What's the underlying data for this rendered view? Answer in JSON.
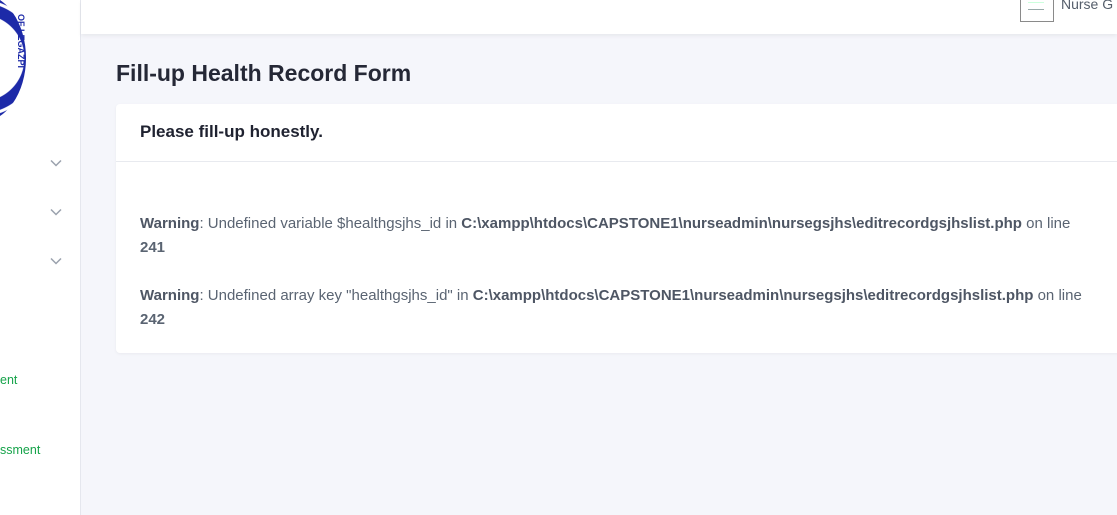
{
  "sidebar": {
    "logo_text": "OF LEGAZPI",
    "links": [
      {
        "label": "ent"
      },
      {
        "label": "ssment"
      }
    ]
  },
  "topbar": {
    "user_name": "Nurse G"
  },
  "main": {
    "page_title": "Fill-up Health Record Form",
    "card_header": "Please fill-up honestly."
  },
  "warnings": [
    {
      "label": "Warning",
      "sep": ": ",
      "message": "Undefined variable $healthgsjhs_id in ",
      "path": "C:\\xampp\\htdocs\\CAPSTONE1\\nurseadmin\\nursegsjhs\\editrecordgsjhslist.php",
      "on_line": " on line",
      "line_number": "241"
    },
    {
      "label": "Warning",
      "sep": ": ",
      "message": "Undefined array key \"healthgsjhs_id\" in ",
      "path": "C:\\xampp\\htdocs\\CAPSTONE1\\nurseadmin\\nursegsjhs\\editrecordgsjhslist.php",
      "on_line": " on line",
      "line_number": "242"
    }
  ],
  "colors": {
    "accent_green": "#16a34a",
    "logo_blue": "#1d2aa8",
    "background": "#f5f6fb"
  }
}
